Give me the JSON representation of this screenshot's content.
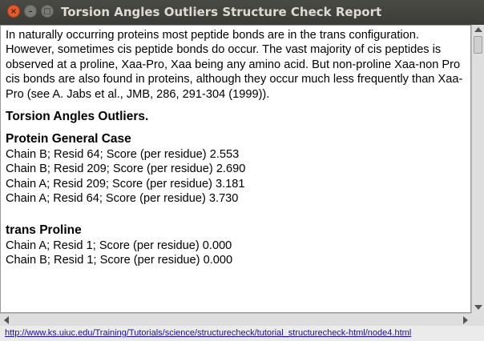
{
  "window": {
    "title": "Torsion Angles Outliers Structure Check Report",
    "close_glyph": "×",
    "min_glyph": "–",
    "max_glyph": "□"
  },
  "report": {
    "intro": "In naturally occurring proteins most peptide bonds are in the trans configuration. However, sometimes cis peptide bonds do occur. The vast majority of cis peptides is observed at a proline, Xaa-Pro, Xaa being any amino acid. But non-proline Xaa-non Pro cis bonds are also found in proteins, although they occur much less frequently than Xaa-Pro (see A. Jabs et al., JMB, 286, 291-304 (1999)).",
    "heading": "Torsion Angles Outliers.",
    "sections": [
      {
        "title": "Protein General Case",
        "rows": [
          "Chain B; Resid 64; Score (per residue) 2.553",
          "Chain B; Resid 209; Score (per residue) 2.690",
          "Chain A; Resid 209; Score (per residue) 3.181",
          "Chain A; Resid 64; Score (per residue) 3.730"
        ]
      },
      {
        "title": "trans Proline",
        "rows": [
          "Chain A; Resid 1; Score (per residue) 0.000",
          "Chain B; Resid 1; Score (per residue) 0.000"
        ]
      }
    ]
  },
  "status": {
    "url": "http://www.ks.uiuc.edu/Training/Tutorials/science/structurecheck/tutorial_structurecheck-html/node4.html"
  }
}
